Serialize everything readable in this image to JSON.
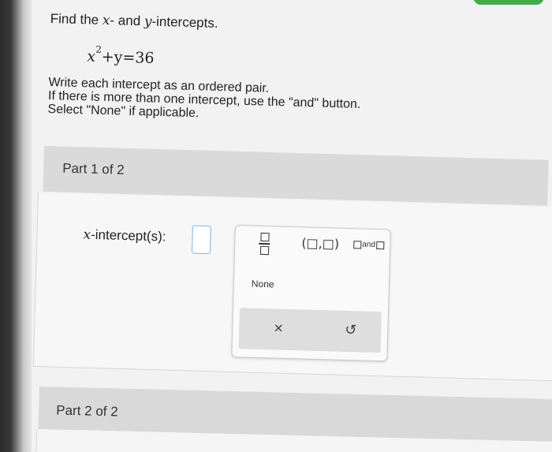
{
  "question": {
    "title_prefix": "Find the ",
    "x_var": "x",
    "title_mid": "- and ",
    "y_var": "y",
    "title_suffix": "-intercepts.",
    "equation": {
      "base": "x",
      "exponent": "2",
      "rest": "+y=36"
    },
    "instructions": [
      "Write each intercept as an ordered pair.",
      "If there is more than one intercept, use the \"and\" button.",
      "Select \"None\" if applicable."
    ]
  },
  "part1": {
    "header": "Part 1 of 2",
    "label_var": "x",
    "label_rest": "-intercept(s):",
    "palette": {
      "pair_label": "(□,□)",
      "and_label": "and",
      "none_label": "None",
      "clear_symbol": "×",
      "undo_symbol": "↺"
    }
  },
  "part2": {
    "header": "Part 2 of 2"
  },
  "colors": {
    "accent_green": "#3fae4b",
    "input_border": "#7fb3e0"
  },
  "icons": {
    "fraction": "fraction-icon",
    "ordered_pair": "ordered-pair-icon",
    "and": "and-icon",
    "clear": "close-icon",
    "undo": "undo-icon"
  }
}
